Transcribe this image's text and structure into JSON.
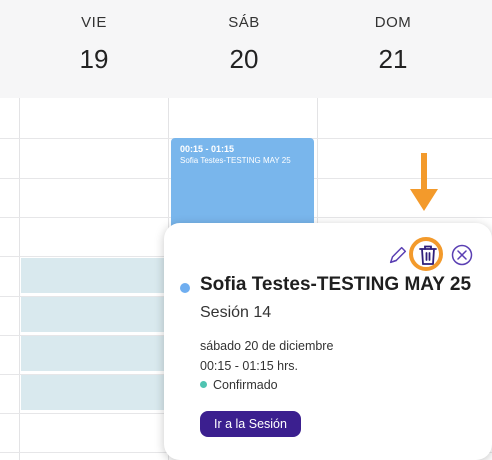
{
  "days": [
    {
      "dow": "VIE",
      "num": "19"
    },
    {
      "dow": "SÁB",
      "num": "20"
    },
    {
      "dow": "DOM",
      "num": "21"
    }
  ],
  "calendar_event": {
    "time": "00:15 - 01:15",
    "title": "Sofia Testes-TESTING MAY 25"
  },
  "popover": {
    "title": "Sofia Testes-TESTING MAY 25",
    "subtitle": "Sesión 14",
    "date": "sábado 20 de diciembre",
    "time": "00:15 - 01:15 hrs.",
    "status": "Confirmado",
    "button_label": "Ir a la Sesión",
    "actions": [
      "edit-icon",
      "trash-icon",
      "close-icon"
    ]
  },
  "colors": {
    "event_blue": "#79b6ec",
    "blocked": "#d9e9ee",
    "primary": "#3b1f8f",
    "status_green": "#4fc3b1",
    "highlight_orange": "#f39a2b"
  }
}
